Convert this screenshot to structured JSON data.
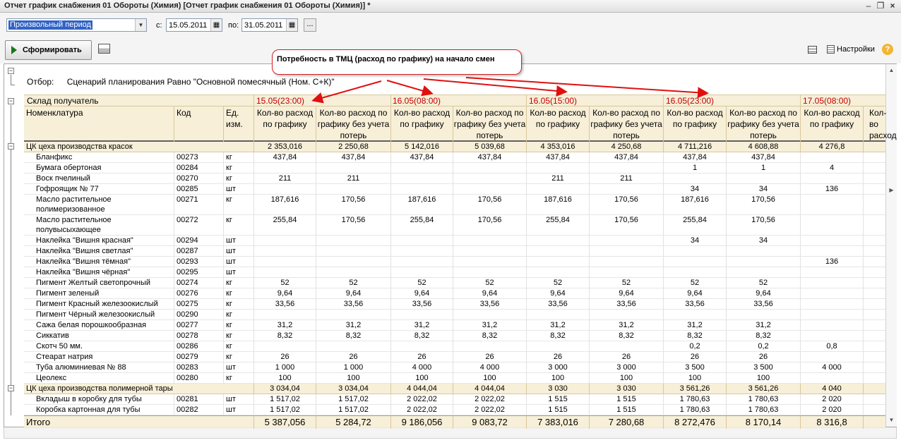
{
  "window": {
    "title": "Отчет график снабжения 01 Обороты (Химия) [Отчет график снабжения 01 Обороты (Химия)] *",
    "buttons": [
      "minimize",
      "maximize",
      "close"
    ]
  },
  "period": {
    "select_value": "Произвольный период",
    "from_label": "с:",
    "from_value": "15.05.2011",
    "to_label": "по:",
    "to_value": "31.05.2011",
    "more_label": "..."
  },
  "toolbar": {
    "run_label": "Сформировать",
    "settings_label": "Настройки",
    "help_label": "?"
  },
  "callout": {
    "text": "Потребность в ТМЦ (расход по графику) на начало смен"
  },
  "filter": {
    "label": "Отбор:",
    "value": "Сценарий планирования Равно \"Основной помесячный (Ном. С+К)\""
  },
  "header": {
    "warehouse_label": "Склад получатель",
    "dates": [
      "15.05(23:00)",
      "16.05(08:00)",
      "16.05(15:00)",
      "16.05(23:00)",
      "17.05(08:00)"
    ],
    "col_name": "Номенклатура",
    "col_code": "Код",
    "col_unit": "Ед.\nизм.",
    "col_qty": "Кол-во расход по графику",
    "col_qty_nl": "Кол-во расход по графику без учета потерь",
    "col_partial": "Кол-во расход по"
  },
  "table": {
    "groups": [
      {
        "name": "ЦК цеха производства красок",
        "values": [
          "2 353,016",
          "2 250,68",
          "5 142,016",
          "5 039,68",
          "4 353,016",
          "4 250,68",
          "4 711,216",
          "4 608,88",
          "4 276,8"
        ],
        "rows": [
          {
            "name": "Бланфикс",
            "code": "00273",
            "unit": "кг",
            "values": [
              "437,84",
              "437,84",
              "437,84",
              "437,84",
              "437,84",
              "437,84",
              "437,84",
              "437,84",
              ""
            ]
          },
          {
            "name": "Бумага обертоная",
            "code": "00284",
            "unit": "кг",
            "values": [
              "",
              "",
              "",
              "",
              "",
              "",
              "1",
              "1",
              "4"
            ]
          },
          {
            "name": "Воск пчелиный",
            "code": "00270",
            "unit": "кг",
            "values": [
              "211",
              "211",
              "",
              "",
              "211",
              "211",
              "",
              "",
              ""
            ]
          },
          {
            "name": "Гофроящик № 77",
            "code": "00285",
            "unit": "шт",
            "values": [
              "",
              "",
              "",
              "",
              "",
              "",
              "34",
              "34",
              "136"
            ]
          },
          {
            "name": "Масло растительное полимеризованное",
            "code": "00271",
            "unit": "кг",
            "tall": true,
            "values": [
              "187,616",
              "170,56",
              "187,616",
              "170,56",
              "187,616",
              "170,56",
              "187,616",
              "170,56",
              ""
            ]
          },
          {
            "name": "Масло растительное полувысыхающее",
            "code": "00272",
            "unit": "кг",
            "tall": true,
            "values": [
              "255,84",
              "170,56",
              "255,84",
              "170,56",
              "255,84",
              "170,56",
              "255,84",
              "170,56",
              ""
            ]
          },
          {
            "name": "Наклейка \"Вишня красная\"",
            "code": "00294",
            "unit": "шт",
            "values": [
              "",
              "",
              "",
              "",
              "",
              "",
              "34",
              "34",
              ""
            ]
          },
          {
            "name": "Наклейка \"Вишня светлая\"",
            "code": "00287",
            "unit": "шт",
            "values": [
              "",
              "",
              "",
              "",
              "",
              "",
              "",
              "",
              ""
            ]
          },
          {
            "name": "Наклейка \"Вишня тёмная\"",
            "code": "00293",
            "unit": "шт",
            "values": [
              "",
              "",
              "",
              "",
              "",
              "",
              "",
              "",
              "136"
            ]
          },
          {
            "name": "Наклейка \"Вишня чёрная\"",
            "code": "00295",
            "unit": "шт",
            "values": [
              "",
              "",
              "",
              "",
              "",
              "",
              "",
              "",
              ""
            ]
          },
          {
            "name": "Пигмент Желтый светопрочный",
            "code": "00274",
            "unit": "кг",
            "values": [
              "52",
              "52",
              "52",
              "52",
              "52",
              "52",
              "52",
              "52",
              ""
            ]
          },
          {
            "name": "Пигмент зеленый",
            "code": "00276",
            "unit": "кг",
            "values": [
              "9,64",
              "9,64",
              "9,64",
              "9,64",
              "9,64",
              "9,64",
              "9,64",
              "9,64",
              ""
            ]
          },
          {
            "name": "Пигмент Красный железоокислый",
            "code": "00275",
            "unit": "кг",
            "values": [
              "33,56",
              "33,56",
              "33,56",
              "33,56",
              "33,56",
              "33,56",
              "33,56",
              "33,56",
              ""
            ]
          },
          {
            "name": "Пигмент Чёрный железоокислый",
            "code": "00290",
            "unit": "кг",
            "values": [
              "",
              "",
              "",
              "",
              "",
              "",
              "",
              "",
              ""
            ]
          },
          {
            "name": "Сажа белая порошкообразная",
            "code": "00277",
            "unit": "кг",
            "values": [
              "31,2",
              "31,2",
              "31,2",
              "31,2",
              "31,2",
              "31,2",
              "31,2",
              "31,2",
              ""
            ]
          },
          {
            "name": "Сиккатив",
            "code": "00278",
            "unit": "кг",
            "values": [
              "8,32",
              "8,32",
              "8,32",
              "8,32",
              "8,32",
              "8,32",
              "8,32",
              "8,32",
              ""
            ]
          },
          {
            "name": "Скотч 50 мм.",
            "code": "00286",
            "unit": "кг",
            "values": [
              "",
              "",
              "",
              "",
              "",
              "",
              "0,2",
              "0,2",
              "0,8"
            ]
          },
          {
            "name": "Стеарат натрия",
            "code": "00279",
            "unit": "кг",
            "values": [
              "26",
              "26",
              "26",
              "26",
              "26",
              "26",
              "26",
              "26",
              ""
            ]
          },
          {
            "name": "Туба алюминиевая № 88",
            "code": "00283",
            "unit": "шт",
            "values": [
              "1 000",
              "1 000",
              "4 000",
              "4 000",
              "3 000",
              "3 000",
              "3 500",
              "3 500",
              "4 000"
            ]
          },
          {
            "name": "Цеолекс",
            "code": "00280",
            "unit": "кг",
            "values": [
              "100",
              "100",
              "100",
              "100",
              "100",
              "100",
              "100",
              "100",
              ""
            ]
          }
        ]
      },
      {
        "name": "ЦК цеха производства полимерной тары",
        "values": [
          "3 034,04",
          "3 034,04",
          "4 044,04",
          "4 044,04",
          "3 030",
          "3 030",
          "3 561,26",
          "3 561,26",
          "4 040"
        ],
        "rows": [
          {
            "name": "Вкладыш в коробку для тубы",
            "code": "00281",
            "unit": "шт",
            "values": [
              "1 517,02",
              "1 517,02",
              "2 022,02",
              "2 022,02",
              "1 515",
              "1 515",
              "1 780,63",
              "1 780,63",
              "2 020"
            ]
          },
          {
            "name": "Коробка картонная для тубы",
            "code": "00282",
            "unit": "шт",
            "values": [
              "1 517,02",
              "1 517,02",
              "2 022,02",
              "2 022,02",
              "1 515",
              "1 515",
              "1 780,63",
              "1 780,63",
              "2 020"
            ]
          }
        ]
      }
    ],
    "total": {
      "label": "Итого",
      "values": [
        "5 387,056",
        "5 284,72",
        "9 186,056",
        "9 083,72",
        "7 383,016",
        "7 280,68",
        "8 272,476",
        "8 170,14",
        "8 316,8"
      ]
    }
  },
  "colors": {
    "header_bg": "#f7efd8",
    "date_text": "#c00000",
    "callout_border": "#d42020",
    "selection": "#3163c5"
  }
}
